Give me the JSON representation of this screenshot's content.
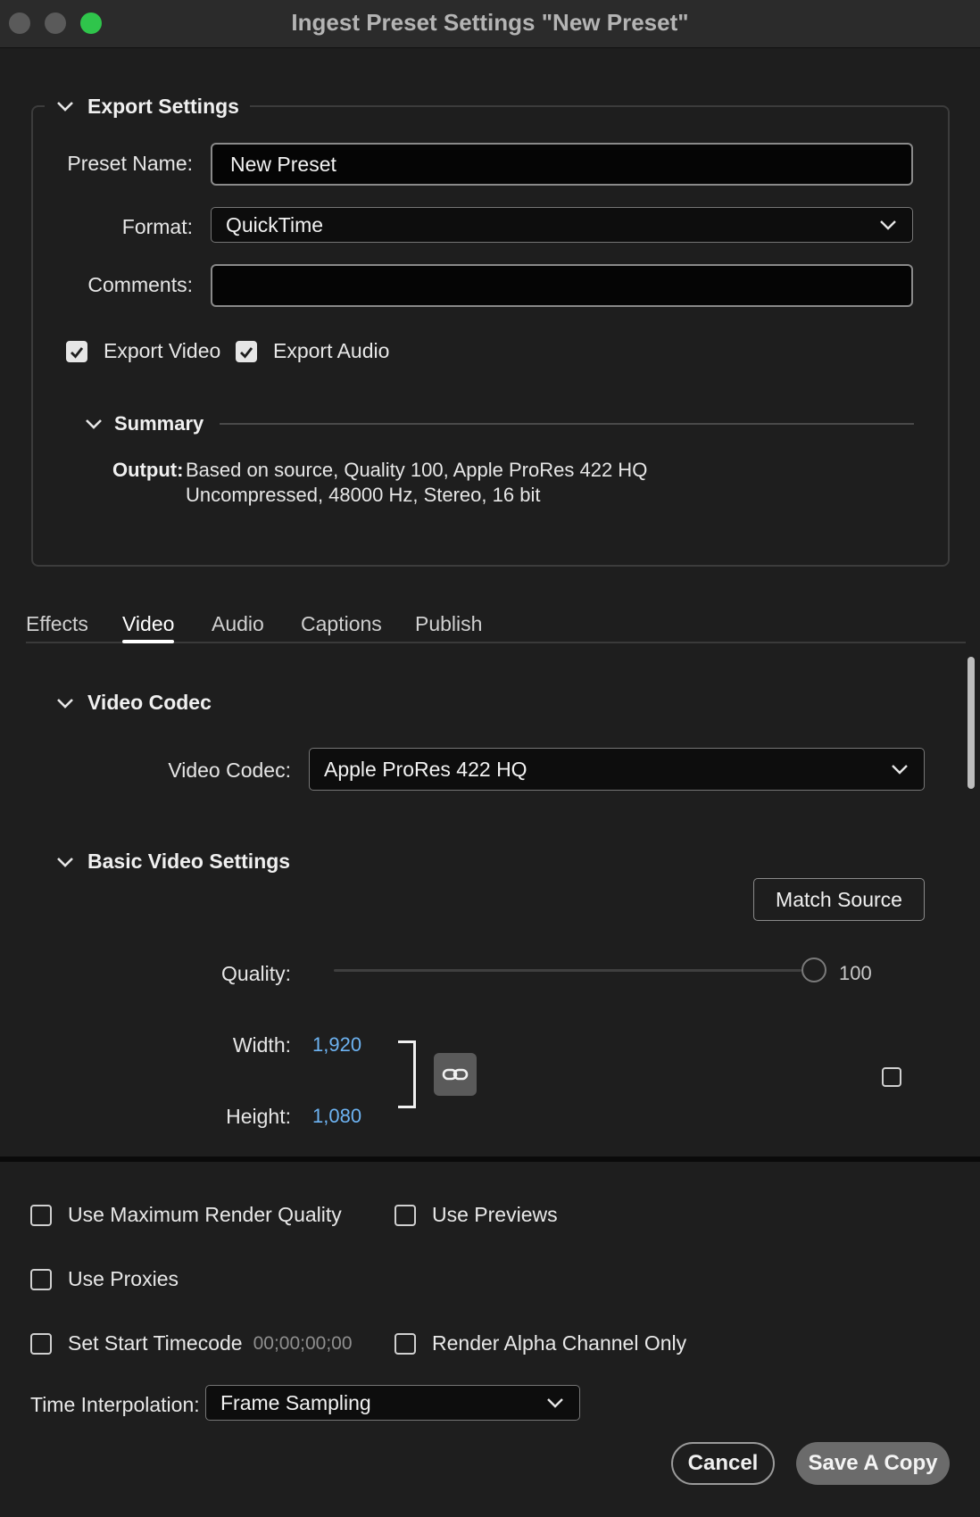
{
  "window": {
    "title": "Ingest Preset Settings \"New Preset\"",
    "traffic_colors": [
      "#5a5a5a",
      "#5a5a5a",
      "#2fc54b"
    ]
  },
  "export_settings": {
    "header": "Export Settings",
    "preset_name_label": "Preset Name:",
    "preset_name_value": "New Preset",
    "format_label": "Format:",
    "format_value": "QuickTime",
    "comments_label": "Comments:",
    "comments_value": "",
    "export_video_label": "Export Video",
    "export_video_checked": true,
    "export_audio_label": "Export Audio",
    "export_audio_checked": true
  },
  "summary": {
    "header": "Summary",
    "output_label": "Output:",
    "output_line1": "Based on source, Quality 100, Apple ProRes 422 HQ",
    "output_line2": "Uncompressed, 48000 Hz, Stereo, 16 bit"
  },
  "tabs": [
    {
      "label": "Effects",
      "active": false
    },
    {
      "label": "Video",
      "active": true
    },
    {
      "label": "Audio",
      "active": false
    },
    {
      "label": "Captions",
      "active": false
    },
    {
      "label": "Publish",
      "active": false
    }
  ],
  "video_codec": {
    "header": "Video Codec",
    "label": "Video Codec:",
    "value": "Apple ProRes 422 HQ"
  },
  "basic_video": {
    "header": "Basic Video Settings",
    "match_source_label": "Match Source",
    "quality_label": "Quality:",
    "quality_value": "100",
    "quality_fraction": 1.0,
    "width_label": "Width:",
    "width_value": "1,920",
    "height_label": "Height:",
    "height_value": "1,080",
    "link_color": "#6db3f2"
  },
  "bottom": {
    "max_render_label": "Use Maximum Render Quality",
    "use_previews_label": "Use Previews",
    "use_proxies_label": "Use Proxies",
    "start_timecode_label": "Set Start Timecode",
    "start_timecode_value": "00;00;00;00",
    "alpha_only_label": "Render Alpha Channel Only",
    "time_interp_label": "Time Interpolation:",
    "time_interp_value": "Frame Sampling",
    "cancel_label": "Cancel",
    "save_label": "Save A Copy"
  }
}
